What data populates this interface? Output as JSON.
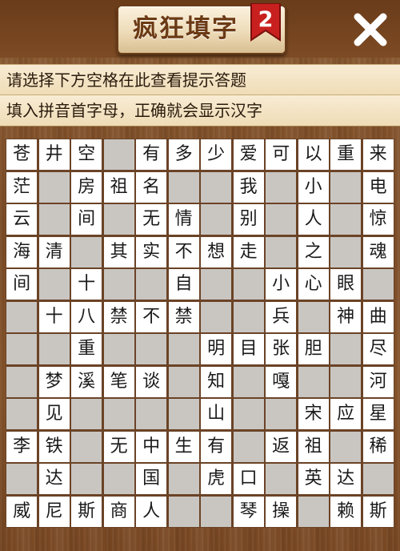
{
  "header": {
    "title": "疯狂填字",
    "level_badge": "2",
    "close_icon": "close-icon"
  },
  "hints": {
    "line1": "请选择下方空格在此查看提示答题",
    "line2": "填入拼音首字母，正确就会显示汉字"
  },
  "colors": {
    "wood": "#7c4b25",
    "cell_white": "#ffffff",
    "cell_blocked": "#c9c6c2",
    "badge_red": "#c8201e",
    "title_text": "#6b3a15"
  },
  "board": {
    "size": 12,
    "rows": [
      [
        "苍",
        "井",
        "空",
        "#",
        "有",
        "多",
        "少",
        "爱",
        "可",
        "以",
        "重",
        "来"
      ],
      [
        "茫",
        "#",
        "房",
        "祖",
        "名",
        "#",
        "#",
        "我",
        "#",
        "小",
        "#",
        "电"
      ],
      [
        "云",
        "#",
        "间",
        "#",
        "无",
        "情",
        "#",
        "别",
        "#",
        "人",
        "#",
        "惊"
      ],
      [
        "海",
        "清",
        "#",
        "其",
        "实",
        "不",
        "想",
        "走",
        "#",
        "之",
        "#",
        "魂"
      ],
      [
        "间",
        "#",
        "十",
        "#",
        "#",
        "自",
        "#",
        "#",
        "小",
        "心",
        "眼",
        "#"
      ],
      [
        "#",
        "十",
        "八",
        "禁",
        "不",
        "禁",
        "#",
        "#",
        "兵",
        "#",
        "神",
        "曲"
      ],
      [
        "#",
        "#",
        "重",
        "#",
        "#",
        "#",
        "明",
        "目",
        "张",
        "胆",
        "#",
        "尽"
      ],
      [
        "#",
        "梦",
        "溪",
        "笔",
        "谈",
        "#",
        "知",
        "#",
        "嘎",
        "#",
        "#",
        "河"
      ],
      [
        "#",
        "见",
        "#",
        "#",
        "#",
        "#",
        "山",
        "#",
        "#",
        "宋",
        "应",
        "星"
      ],
      [
        "李",
        "铁",
        "#",
        "无",
        "中",
        "生",
        "有",
        "#",
        "返",
        "祖",
        "#",
        "稀"
      ],
      [
        "#",
        "达",
        "#",
        "#",
        "国",
        "#",
        "虎",
        "口",
        "#",
        "英",
        "达",
        "#"
      ],
      [
        "威",
        "尼",
        "斯",
        "商",
        "人",
        "#",
        "#",
        "琴",
        "操",
        "#",
        "赖",
        "斯"
      ]
    ]
  }
}
